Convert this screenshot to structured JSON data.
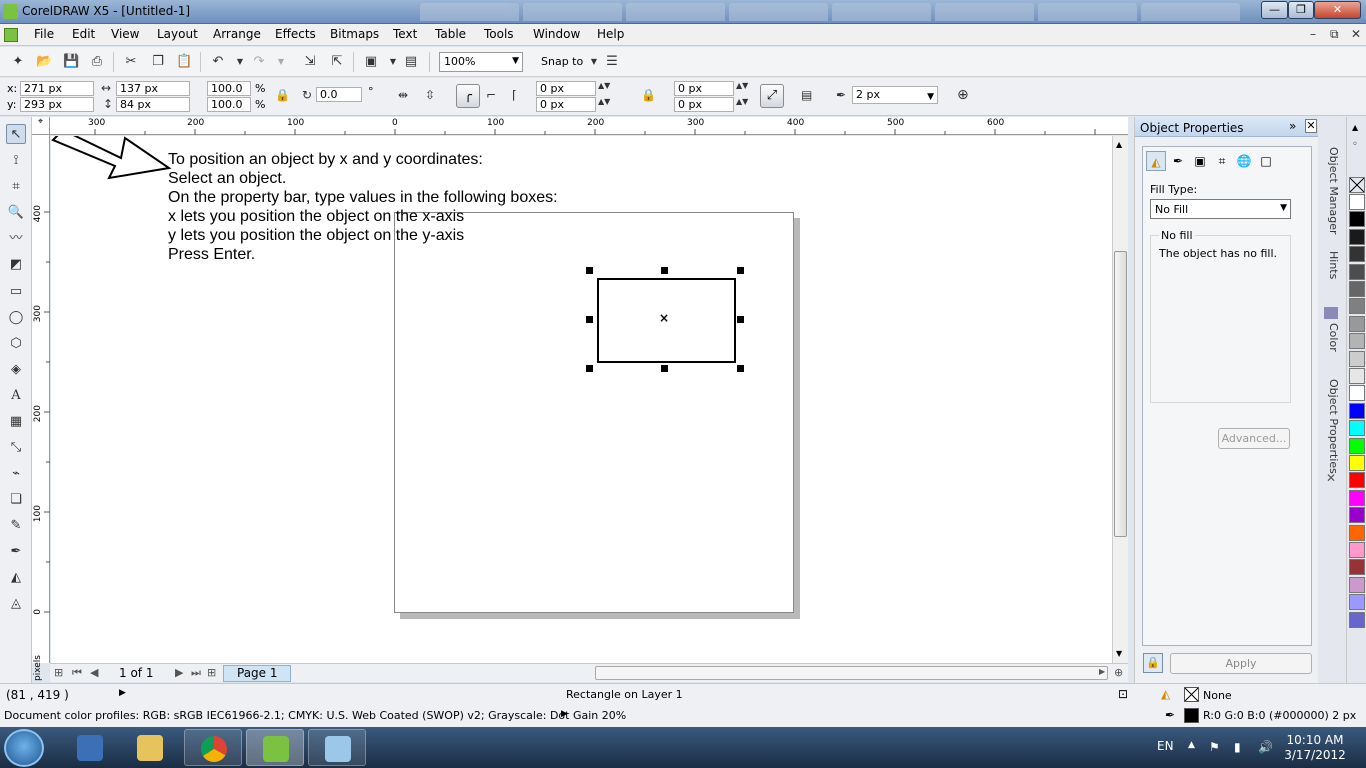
{
  "window": {
    "title": "CorelDRAW X5 - [Untitled-1]",
    "min_glyph": "—",
    "max_glyph": "❐",
    "close_glyph": "✕"
  },
  "menu": {
    "items": [
      "File",
      "Edit",
      "View",
      "Layout",
      "Arrange",
      "Effects",
      "Bitmaps",
      "Text",
      "Table",
      "Tools",
      "Window",
      "Help"
    ],
    "mdi_min": "–",
    "mdi_restore": "⧉",
    "mdi_close": "✕"
  },
  "toolbar": {
    "zoom": "100%",
    "snap_label": "Snap to"
  },
  "propbar": {
    "x_label": "x:",
    "x_value": "271 px",
    "y_label": "y:",
    "y_value": "293 px",
    "width_value": "137 px",
    "height_value": "84 px",
    "scale_x": "100.0",
    "scale_y": "100.0",
    "pct": "%",
    "rotation": "0.0",
    "degree": "°",
    "corner_tl": "0 px",
    "corner_bl": "0 px",
    "corner_tr": "0 px",
    "corner_br": "0 px",
    "outline_width": "2 px"
  },
  "rulers": {
    "unit": "pixels",
    "top_labels": [
      "300",
      "200",
      "100",
      "0",
      "100",
      "200",
      "300",
      "400",
      "500",
      "600"
    ],
    "left_labels": [
      "400",
      "300",
      "200",
      "100",
      "0"
    ],
    "left_unit": "pixels"
  },
  "canvas": {
    "tutorial_lines": [
      "To position an object by x and y coordinates:",
      "Select an object.",
      "On the property bar, type values in the following boxes:",
      "x lets you position the object on the x-axis",
      "y lets you position the object on the y-axis",
      "Press Enter."
    ],
    "center_marker": "×"
  },
  "pagenav": {
    "count": "1 of 1",
    "tab": "Page 1"
  },
  "docker": {
    "title": "Object Properties",
    "fill_type_label": "Fill Type:",
    "fill_type_value": "No Fill",
    "group_legend": "No fill",
    "group_desc": "The object has no fill.",
    "advanced": "Advanced...",
    "apply": "Apply"
  },
  "docker_tabs": [
    "Object Manager",
    "Hints",
    "Color",
    "Object Properties"
  ],
  "palette": {
    "colors": [
      "#ffffff",
      "#000000",
      "#1a1a1a",
      "#333333",
      "#4d4d4d",
      "#666666",
      "#808080",
      "#999999",
      "#b3b3b3",
      "#cccccc",
      "#e6e6e6",
      "#ffffff",
      "#0000ff",
      "#00ffff",
      "#00ff00",
      "#ffff00",
      "#ff0000",
      "#ff00ff",
      "#9900cc",
      "#ff6600",
      "#ff99cc",
      "#993333",
      "#cc99cc",
      "#9999ff",
      "#6666cc"
    ]
  },
  "status": {
    "coords": "(81   , 419   )",
    "object_info": "Rectangle on Layer 1",
    "fill": "None",
    "profiles": "Document color profiles: RGB: sRGB IEC61966-2.1; CMYK: U.S. Web Coated (SWOP) v2; Grayscale: Dot Gain 20%",
    "outline": "R:0 G:0 B:0 (#000000)  2 px"
  },
  "taskbar": {
    "lang": "EN",
    "time": "10:10 AM",
    "date": "3/17/2012"
  }
}
